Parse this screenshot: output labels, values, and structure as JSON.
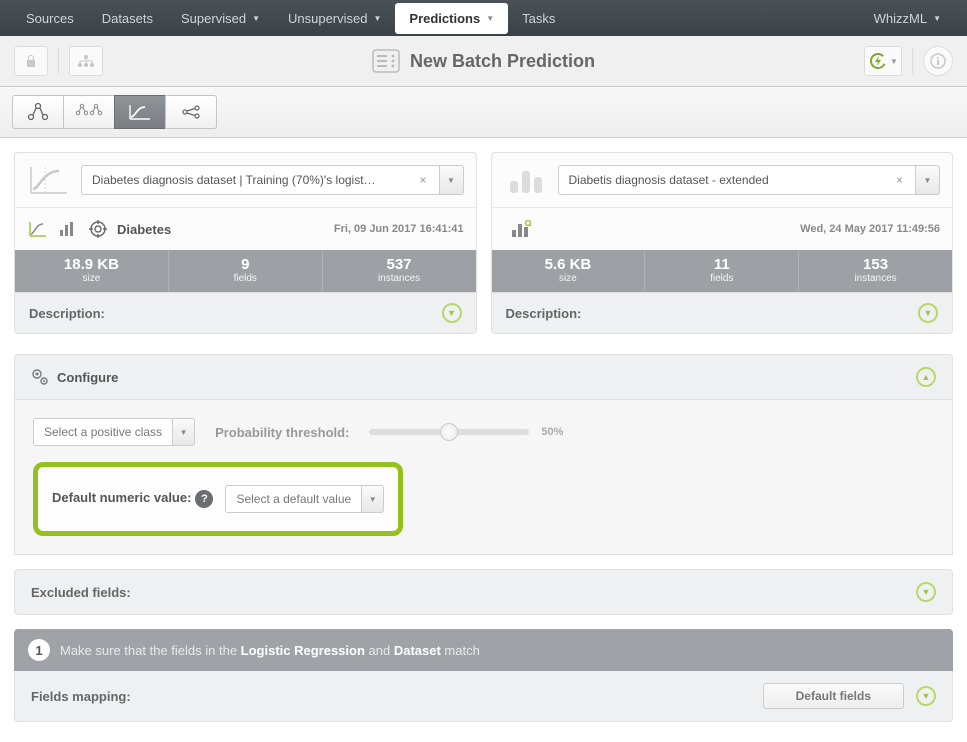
{
  "nav": {
    "sources": "Sources",
    "datasets": "Datasets",
    "supervised": "Supervised",
    "unsupervised": "Unsupervised",
    "predictions": "Predictions",
    "tasks": "Tasks",
    "whizzml": "WhizzML"
  },
  "title": "New Batch Prediction",
  "left_panel": {
    "select_value": "Diabetes diagnosis dataset | Training (70%)'s logist…",
    "target": "Diabetes",
    "datetime": "Fri, 09 Jun 2017 16:41:41",
    "stats": {
      "size": "18.9 KB",
      "size_label": "size",
      "fields": "9",
      "fields_label": "fields",
      "instances": "537",
      "instances_label": "instances"
    },
    "description_label": "Description:"
  },
  "right_panel": {
    "select_value": "Diabetis diagnosis dataset - extended",
    "datetime": "Wed, 24 May 2017 11:49:56",
    "stats": {
      "size": "5.6 KB",
      "size_label": "size",
      "fields": "11",
      "fields_label": "fields",
      "instances": "153",
      "instances_label": "instances"
    },
    "description_label": "Description:"
  },
  "configure": {
    "label": "Configure",
    "positive_class_placeholder": "Select a positive class",
    "prob_threshold_label": "Probability threshold:",
    "prob_threshold_value": "50%",
    "default_numeric_label": "Default numeric value:",
    "default_numeric_placeholder": "Select a default value",
    "excluded_fields_label": "Excluded fields:",
    "step1_text_a": "Make sure that the fields in the ",
    "step1_bold_a": "Logistic Regression",
    "step1_text_b": " and ",
    "step1_bold_b": "Dataset",
    "step1_text_c": " match",
    "step1_number": "1",
    "fields_mapping_label": "Fields mapping:",
    "default_fields_button": "Default fields"
  }
}
